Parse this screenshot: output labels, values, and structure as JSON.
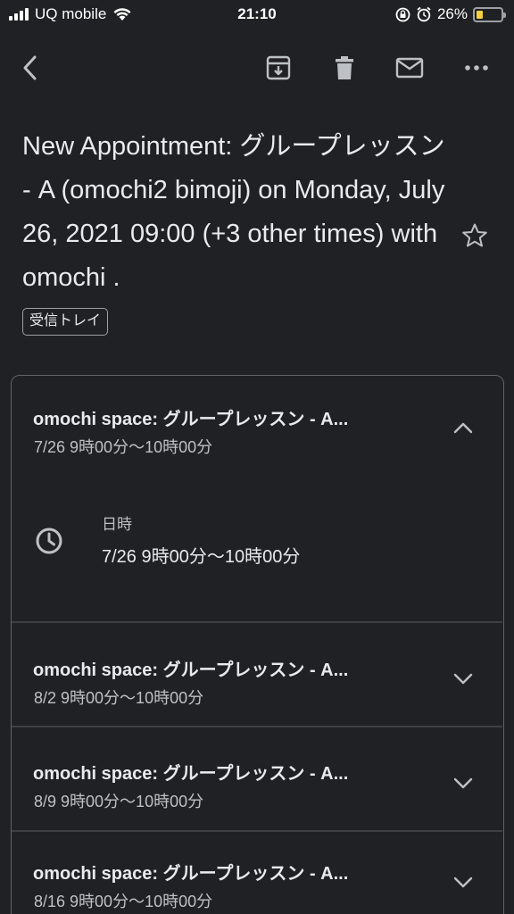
{
  "status_bar": {
    "carrier": "UQ mobile",
    "time": "21:10",
    "battery": "26%",
    "battery_level": 0.26,
    "icons": [
      "signal-icon",
      "wifi-icon",
      "lock-rotation-icon",
      "alarm-icon",
      "battery-icon"
    ]
  },
  "toolbar": {
    "icons": [
      "back-arrow-icon",
      "archive-icon",
      "trash-icon",
      "mail-icon",
      "more-icon"
    ]
  },
  "email": {
    "subject": "New Appointment: グループレッスン - A (omochi2 bimoji) on Monday, July 26, 2021 09:00 (+3 other times) with omochi .",
    "label": "受信トレイ"
  },
  "appointments": [
    {
      "title": "omochi space: グループレッスン - A...",
      "time": "7/26 9時00分〜10時00分",
      "expanded": true,
      "detail_label": "日時",
      "detail_value": "7/26 9時00分〜10時00分"
    },
    {
      "title": "omochi space: グループレッスン - A...",
      "time": "8/2 9時00分〜10時00分",
      "expanded": false
    },
    {
      "title": "omochi space: グループレッスン - A...",
      "time": "8/9 9時00分〜10時00分",
      "expanded": false
    },
    {
      "title": "omochi space: グループレッスン - A...",
      "time": "8/16 9時00分〜10時00分",
      "expanded": false
    }
  ],
  "colors": {
    "background": "#202124",
    "text": "#e8eaed",
    "secondary_text": "#bdc1c6",
    "icon": "#bdc1c6",
    "battery_fill": "#f4d03f"
  }
}
